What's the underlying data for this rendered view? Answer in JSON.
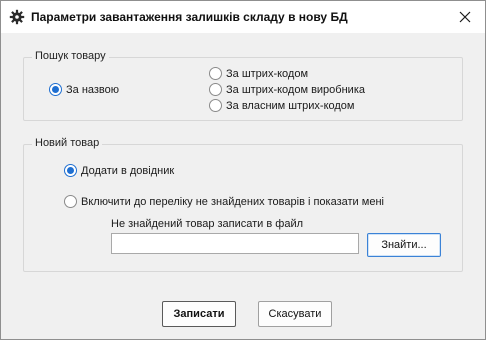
{
  "window": {
    "title": "Параметри завантаження залишків складу в нову БД",
    "icon": "gear-icon",
    "close_icon": "close-icon"
  },
  "search_group": {
    "legend": "Пошук товару",
    "options": [
      {
        "label": "За назвою",
        "checked": true
      },
      {
        "label": "За штрих-кодом",
        "checked": false
      },
      {
        "label": "За штрих-кодом виробника",
        "checked": false
      },
      {
        "label": "За власним штрих-кодом",
        "checked": false
      }
    ]
  },
  "new_item_group": {
    "legend": "Новий товар",
    "options": [
      {
        "label": "Додати в довідник",
        "checked": true
      },
      {
        "label": "Включити до переліку не знайдених товарів і показати мені",
        "checked": false
      }
    ],
    "file_label": "Не знайдений товар записати в файл",
    "file_value": "",
    "browse_label": "Знайти..."
  },
  "footer": {
    "save_label": "Записати",
    "cancel_label": "Скасувати"
  },
  "colors": {
    "accent": "#1f6fd1",
    "background": "#f0f0f0"
  }
}
